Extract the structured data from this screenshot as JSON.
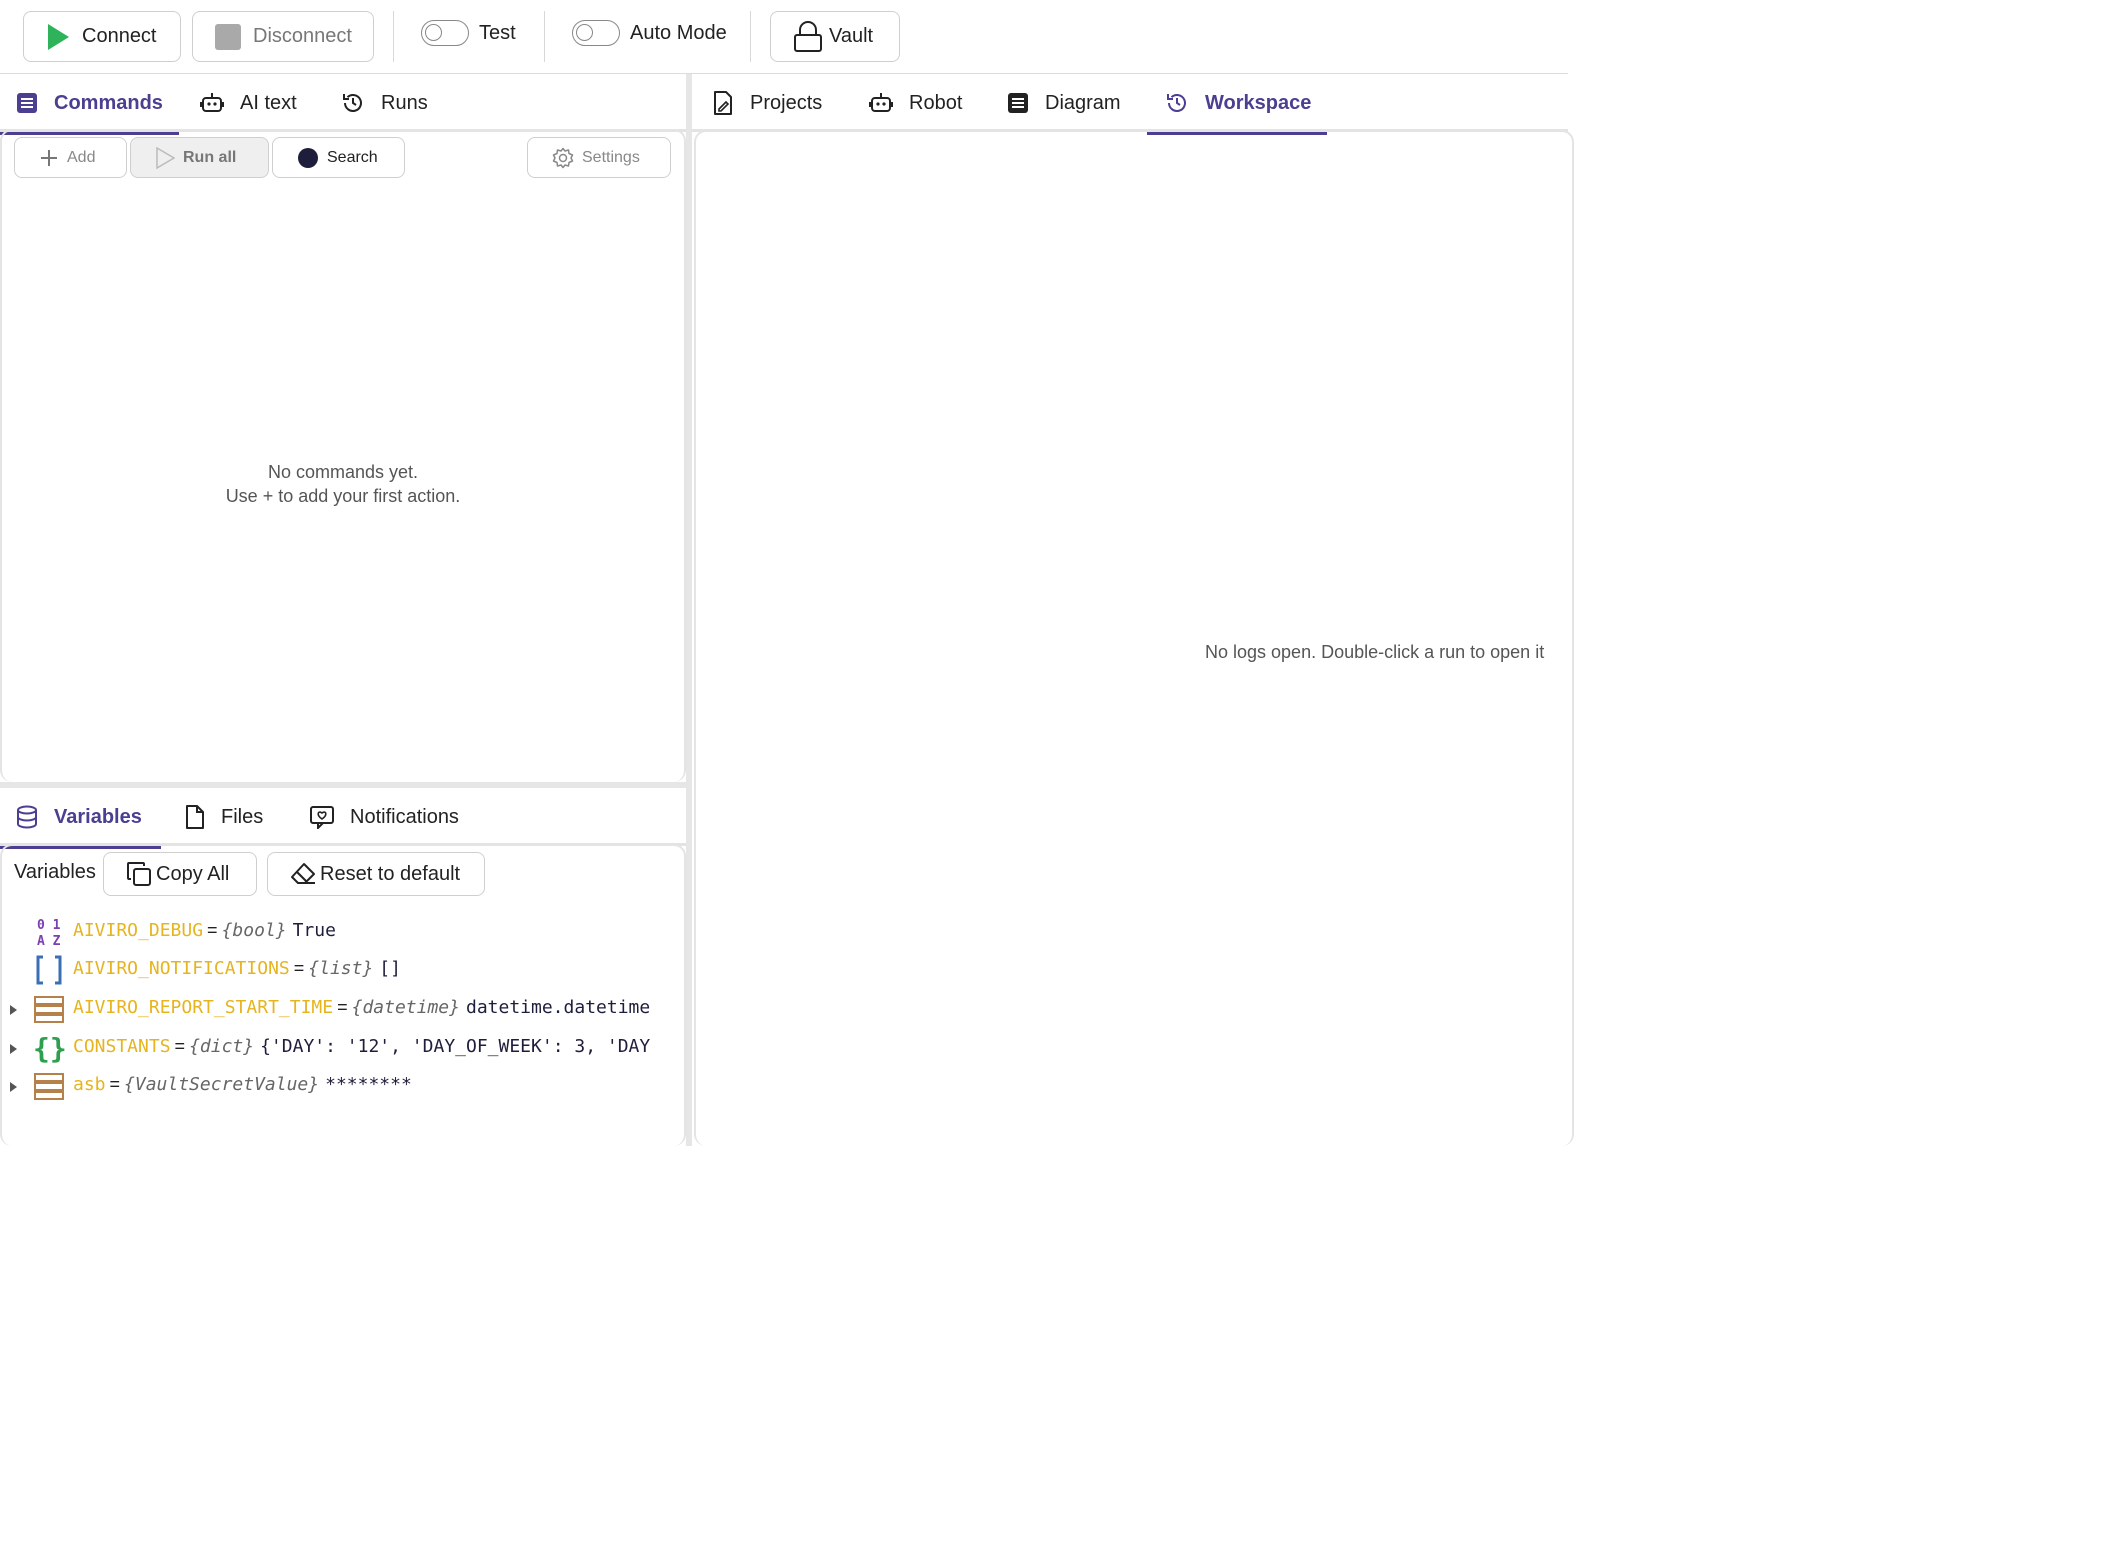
{
  "toolbar": {
    "connect_label": "Connect",
    "disconnect_label": "Disconnect",
    "test_label": "Test",
    "auto_mode_label": "Auto Mode",
    "vault_label": "Vault"
  },
  "left_tabs": [
    {
      "label": "Commands",
      "icon": "list-icon",
      "active": true
    },
    {
      "label": "AI text",
      "icon": "robot-icon",
      "active": false
    },
    {
      "label": "Runs",
      "icon": "history-icon",
      "active": false
    }
  ],
  "right_tabs": [
    {
      "label": "Projects",
      "icon": "file-edit-icon",
      "active": false
    },
    {
      "label": "Robot",
      "icon": "robot-icon",
      "active": false
    },
    {
      "label": "Diagram",
      "icon": "list-icon",
      "active": false
    },
    {
      "label": "Workspace",
      "icon": "history-icon",
      "active": true
    }
  ],
  "commands": {
    "add_label": "Add",
    "run_all_label": "Run all",
    "search_label": "Search",
    "settings_label": "Settings",
    "empty_line1": "No commands yet.",
    "empty_line2": "Use + to add your first action."
  },
  "workspace": {
    "empty_message": "No logs open. Double-click a run to open it"
  },
  "bottom_tabs": [
    {
      "label": "Variables",
      "icon": "database-icon",
      "active": true
    },
    {
      "label": "Files",
      "icon": "file-icon",
      "active": false
    },
    {
      "label": "Notifications",
      "icon": "notification-icon",
      "active": false
    }
  ],
  "variables": {
    "section_label": "Variables",
    "copy_all_label": "Copy All",
    "reset_label": "Reset to default",
    "items": [
      {
        "name": "AIVIRO_DEBUG",
        "type": "{bool}",
        "value": "True",
        "icon": "bool-icon",
        "expandable": false
      },
      {
        "name": "AIVIRO_NOTIFICATIONS",
        "type": "{list}",
        "value": "[]",
        "icon": "list-brackets-icon",
        "expandable": false
      },
      {
        "name": "AIVIRO_REPORT_START_TIME",
        "type": "{datetime}",
        "value": "datetime.datetime",
        "icon": "object-icon",
        "expandable": true
      },
      {
        "name": "CONSTANTS",
        "type": "{dict}",
        "value": "{'DAY': '12', 'DAY_OF_WEEK': 3, 'DAY",
        "icon": "dict-braces-icon",
        "expandable": true
      },
      {
        "name": "asb",
        "type": "{VaultSecretValue}",
        "value": "********",
        "icon": "object-icon",
        "expandable": true
      }
    ]
  },
  "colors": {
    "accent": "#4a3f91",
    "connect_green": "#2fb35a",
    "var_name": "#e6b41e",
    "bool_icon": "#7a3fb0",
    "list_icon": "#3a6fb5",
    "dict_icon": "#2e9e4f",
    "object_icon": "#b5804a"
  }
}
